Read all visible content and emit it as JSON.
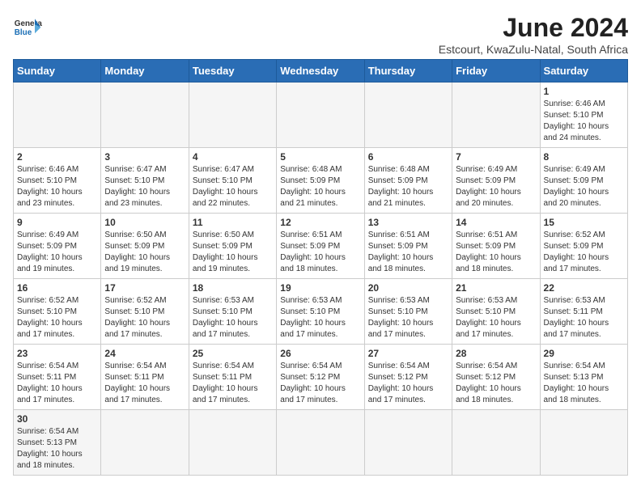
{
  "header": {
    "logo_general": "General",
    "logo_blue": "Blue",
    "month_title": "June 2024",
    "location": "Estcourt, KwaZulu-Natal, South Africa"
  },
  "weekdays": [
    "Sunday",
    "Monday",
    "Tuesday",
    "Wednesday",
    "Thursday",
    "Friday",
    "Saturday"
  ],
  "weeks": [
    [
      {
        "day": "",
        "info": ""
      },
      {
        "day": "",
        "info": ""
      },
      {
        "day": "",
        "info": ""
      },
      {
        "day": "",
        "info": ""
      },
      {
        "day": "",
        "info": ""
      },
      {
        "day": "",
        "info": ""
      },
      {
        "day": "1",
        "info": "Sunrise: 6:46 AM\nSunset: 5:10 PM\nDaylight: 10 hours\nand 24 minutes."
      }
    ],
    [
      {
        "day": "2",
        "info": "Sunrise: 6:46 AM\nSunset: 5:10 PM\nDaylight: 10 hours\nand 23 minutes."
      },
      {
        "day": "3",
        "info": "Sunrise: 6:47 AM\nSunset: 5:10 PM\nDaylight: 10 hours\nand 23 minutes."
      },
      {
        "day": "4",
        "info": "Sunrise: 6:47 AM\nSunset: 5:10 PM\nDaylight: 10 hours\nand 22 minutes."
      },
      {
        "day": "5",
        "info": "Sunrise: 6:48 AM\nSunset: 5:09 PM\nDaylight: 10 hours\nand 21 minutes."
      },
      {
        "day": "6",
        "info": "Sunrise: 6:48 AM\nSunset: 5:09 PM\nDaylight: 10 hours\nand 21 minutes."
      },
      {
        "day": "7",
        "info": "Sunrise: 6:49 AM\nSunset: 5:09 PM\nDaylight: 10 hours\nand 20 minutes."
      },
      {
        "day": "8",
        "info": "Sunrise: 6:49 AM\nSunset: 5:09 PM\nDaylight: 10 hours\nand 20 minutes."
      }
    ],
    [
      {
        "day": "9",
        "info": "Sunrise: 6:49 AM\nSunset: 5:09 PM\nDaylight: 10 hours\nand 19 minutes."
      },
      {
        "day": "10",
        "info": "Sunrise: 6:50 AM\nSunset: 5:09 PM\nDaylight: 10 hours\nand 19 minutes."
      },
      {
        "day": "11",
        "info": "Sunrise: 6:50 AM\nSunset: 5:09 PM\nDaylight: 10 hours\nand 19 minutes."
      },
      {
        "day": "12",
        "info": "Sunrise: 6:51 AM\nSunset: 5:09 PM\nDaylight: 10 hours\nand 18 minutes."
      },
      {
        "day": "13",
        "info": "Sunrise: 6:51 AM\nSunset: 5:09 PM\nDaylight: 10 hours\nand 18 minutes."
      },
      {
        "day": "14",
        "info": "Sunrise: 6:51 AM\nSunset: 5:09 PM\nDaylight: 10 hours\nand 18 minutes."
      },
      {
        "day": "15",
        "info": "Sunrise: 6:52 AM\nSunset: 5:09 PM\nDaylight: 10 hours\nand 17 minutes."
      }
    ],
    [
      {
        "day": "16",
        "info": "Sunrise: 6:52 AM\nSunset: 5:10 PM\nDaylight: 10 hours\nand 17 minutes."
      },
      {
        "day": "17",
        "info": "Sunrise: 6:52 AM\nSunset: 5:10 PM\nDaylight: 10 hours\nand 17 minutes."
      },
      {
        "day": "18",
        "info": "Sunrise: 6:53 AM\nSunset: 5:10 PM\nDaylight: 10 hours\nand 17 minutes."
      },
      {
        "day": "19",
        "info": "Sunrise: 6:53 AM\nSunset: 5:10 PM\nDaylight: 10 hours\nand 17 minutes."
      },
      {
        "day": "20",
        "info": "Sunrise: 6:53 AM\nSunset: 5:10 PM\nDaylight: 10 hours\nand 17 minutes."
      },
      {
        "day": "21",
        "info": "Sunrise: 6:53 AM\nSunset: 5:10 PM\nDaylight: 10 hours\nand 17 minutes."
      },
      {
        "day": "22",
        "info": "Sunrise: 6:53 AM\nSunset: 5:11 PM\nDaylight: 10 hours\nand 17 minutes."
      }
    ],
    [
      {
        "day": "23",
        "info": "Sunrise: 6:54 AM\nSunset: 5:11 PM\nDaylight: 10 hours\nand 17 minutes."
      },
      {
        "day": "24",
        "info": "Sunrise: 6:54 AM\nSunset: 5:11 PM\nDaylight: 10 hours\nand 17 minutes."
      },
      {
        "day": "25",
        "info": "Sunrise: 6:54 AM\nSunset: 5:11 PM\nDaylight: 10 hours\nand 17 minutes."
      },
      {
        "day": "26",
        "info": "Sunrise: 6:54 AM\nSunset: 5:12 PM\nDaylight: 10 hours\nand 17 minutes."
      },
      {
        "day": "27",
        "info": "Sunrise: 6:54 AM\nSunset: 5:12 PM\nDaylight: 10 hours\nand 17 minutes."
      },
      {
        "day": "28",
        "info": "Sunrise: 6:54 AM\nSunset: 5:12 PM\nDaylight: 10 hours\nand 18 minutes."
      },
      {
        "day": "29",
        "info": "Sunrise: 6:54 AM\nSunset: 5:13 PM\nDaylight: 10 hours\nand 18 minutes."
      }
    ],
    [
      {
        "day": "30",
        "info": "Sunrise: 6:54 AM\nSunset: 5:13 PM\nDaylight: 10 hours\nand 18 minutes."
      },
      {
        "day": "",
        "info": ""
      },
      {
        "day": "",
        "info": ""
      },
      {
        "day": "",
        "info": ""
      },
      {
        "day": "",
        "info": ""
      },
      {
        "day": "",
        "info": ""
      },
      {
        "day": "",
        "info": ""
      }
    ]
  ]
}
